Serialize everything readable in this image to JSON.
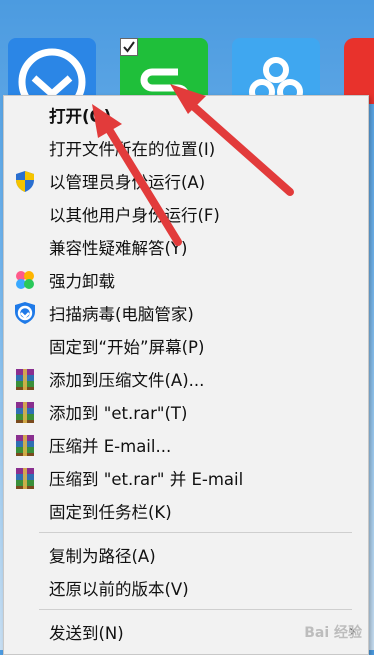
{
  "menu": {
    "items": [
      {
        "label": "打开(O)",
        "icon": "none",
        "bold": true
      },
      {
        "label": "打开文件所在的位置(I)",
        "icon": "none"
      },
      {
        "label": "以管理员身份运行(A)",
        "icon": "uac-shield-icon"
      },
      {
        "label": "以其他用户身份运行(F)",
        "icon": "none"
      },
      {
        "label": "兼容性疑难解答(Y)",
        "icon": "none"
      },
      {
        "label": "强力卸载",
        "icon": "uninstall-icon"
      },
      {
        "label": "扫描病毒(电脑管家)",
        "icon": "pc-manager-shield-icon"
      },
      {
        "label": "固定到“开始”屏幕(P)",
        "icon": "none"
      },
      {
        "label": "添加到压缩文件(A)...",
        "icon": "winrar-icon"
      },
      {
        "label": "添加到 \"et.rar\"(T)",
        "icon": "winrar-icon"
      },
      {
        "label": "压缩并 E-mail...",
        "icon": "winrar-icon"
      },
      {
        "label": "压缩到 \"et.rar\" 并 E-mail",
        "icon": "winrar-icon"
      },
      {
        "label": "固定到任务栏(K)",
        "icon": "none"
      },
      {
        "label": "复制为路径(A)",
        "icon": "none"
      },
      {
        "label": "还原以前的版本(V)",
        "icon": "none"
      },
      {
        "label": "发送到(N)",
        "icon": "none",
        "submenu": true
      }
    ]
  },
  "watermark": "Bai 经验",
  "colors": {
    "arrow": "#e23b3b",
    "menu_bg": "#f2f2f2"
  }
}
